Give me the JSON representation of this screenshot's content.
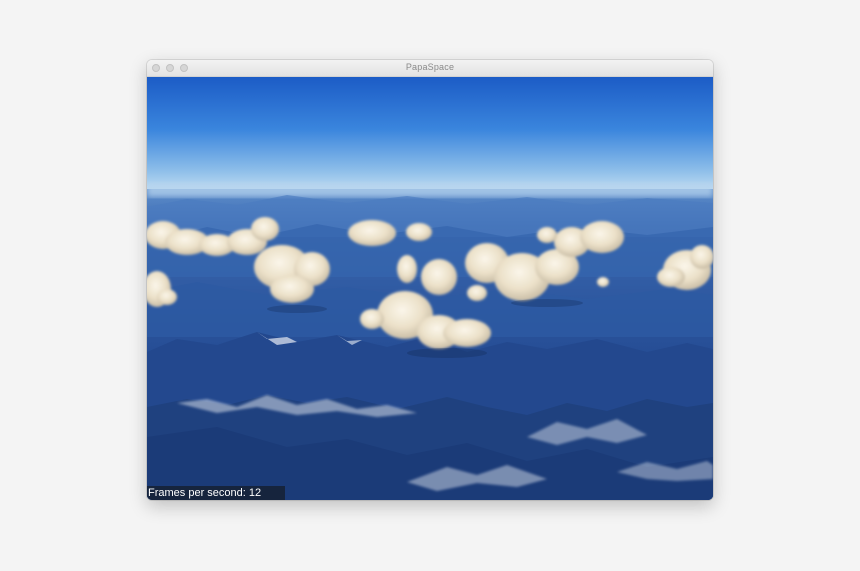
{
  "window": {
    "title": "PapaSpace"
  },
  "overlay": {
    "fps_text": "Frames per second: 12"
  },
  "colors": {
    "sky_top": "#1f5fc8",
    "sky_horizon": "#bcd8ef",
    "mountains": "#1e4487"
  }
}
